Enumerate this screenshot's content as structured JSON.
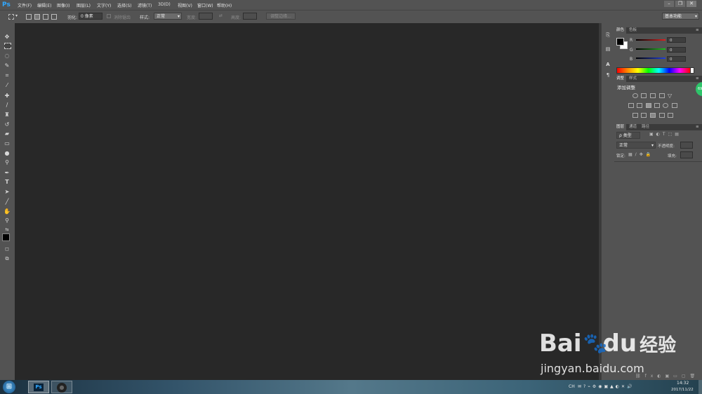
{
  "app": {
    "logo": "Ps"
  },
  "menu": [
    "文件(F)",
    "编辑(E)",
    "图像(I)",
    "图层(L)",
    "文字(Y)",
    "选择(S)",
    "滤镜(T)",
    "3D(D)",
    "视图(V)",
    "窗口(W)",
    "帮助(H)"
  ],
  "window_controls": {
    "minimize": "–",
    "restore": "❐",
    "close": "✕"
  },
  "options": {
    "feather_label": "羽化:",
    "feather_value": "0 像素",
    "antialias_label": "消除锯齿",
    "style_label": "样式:",
    "style_value": "正常",
    "width_label": "宽度:",
    "height_label": "高度:",
    "refine_edge": "调整边缘...",
    "workspace": "基本功能"
  },
  "panels": {
    "color": {
      "tabs": [
        "颜色",
        "色板"
      ],
      "channels": [
        {
          "label": "R",
          "value": "0",
          "color": "#e02020"
        },
        {
          "label": "G",
          "value": "0",
          "color": "#20c020"
        },
        {
          "label": "B",
          "value": "0",
          "color": "#2040e0"
        }
      ]
    },
    "adjustments": {
      "tabs": [
        "调整",
        "样式"
      ],
      "title": "添加调整",
      "badge": "69"
    },
    "layers": {
      "tabs": [
        "图层",
        "通道",
        "路径"
      ],
      "filter": "ρ 类型",
      "blend_mode": "正常",
      "opacity_label": "不透明度:",
      "lock_label": "锁定:",
      "fill_label": "填充:"
    }
  },
  "taskbar": {
    "start": "⊞",
    "apps": [
      "Ps",
      "●"
    ],
    "lang": "CH",
    "time": "14:32",
    "date": "2017/11/22"
  },
  "watermark": {
    "brand": "Bai",
    "brand_suffix": "du",
    "brand_cn": "经验",
    "url": "jingyan.baidu.com"
  }
}
